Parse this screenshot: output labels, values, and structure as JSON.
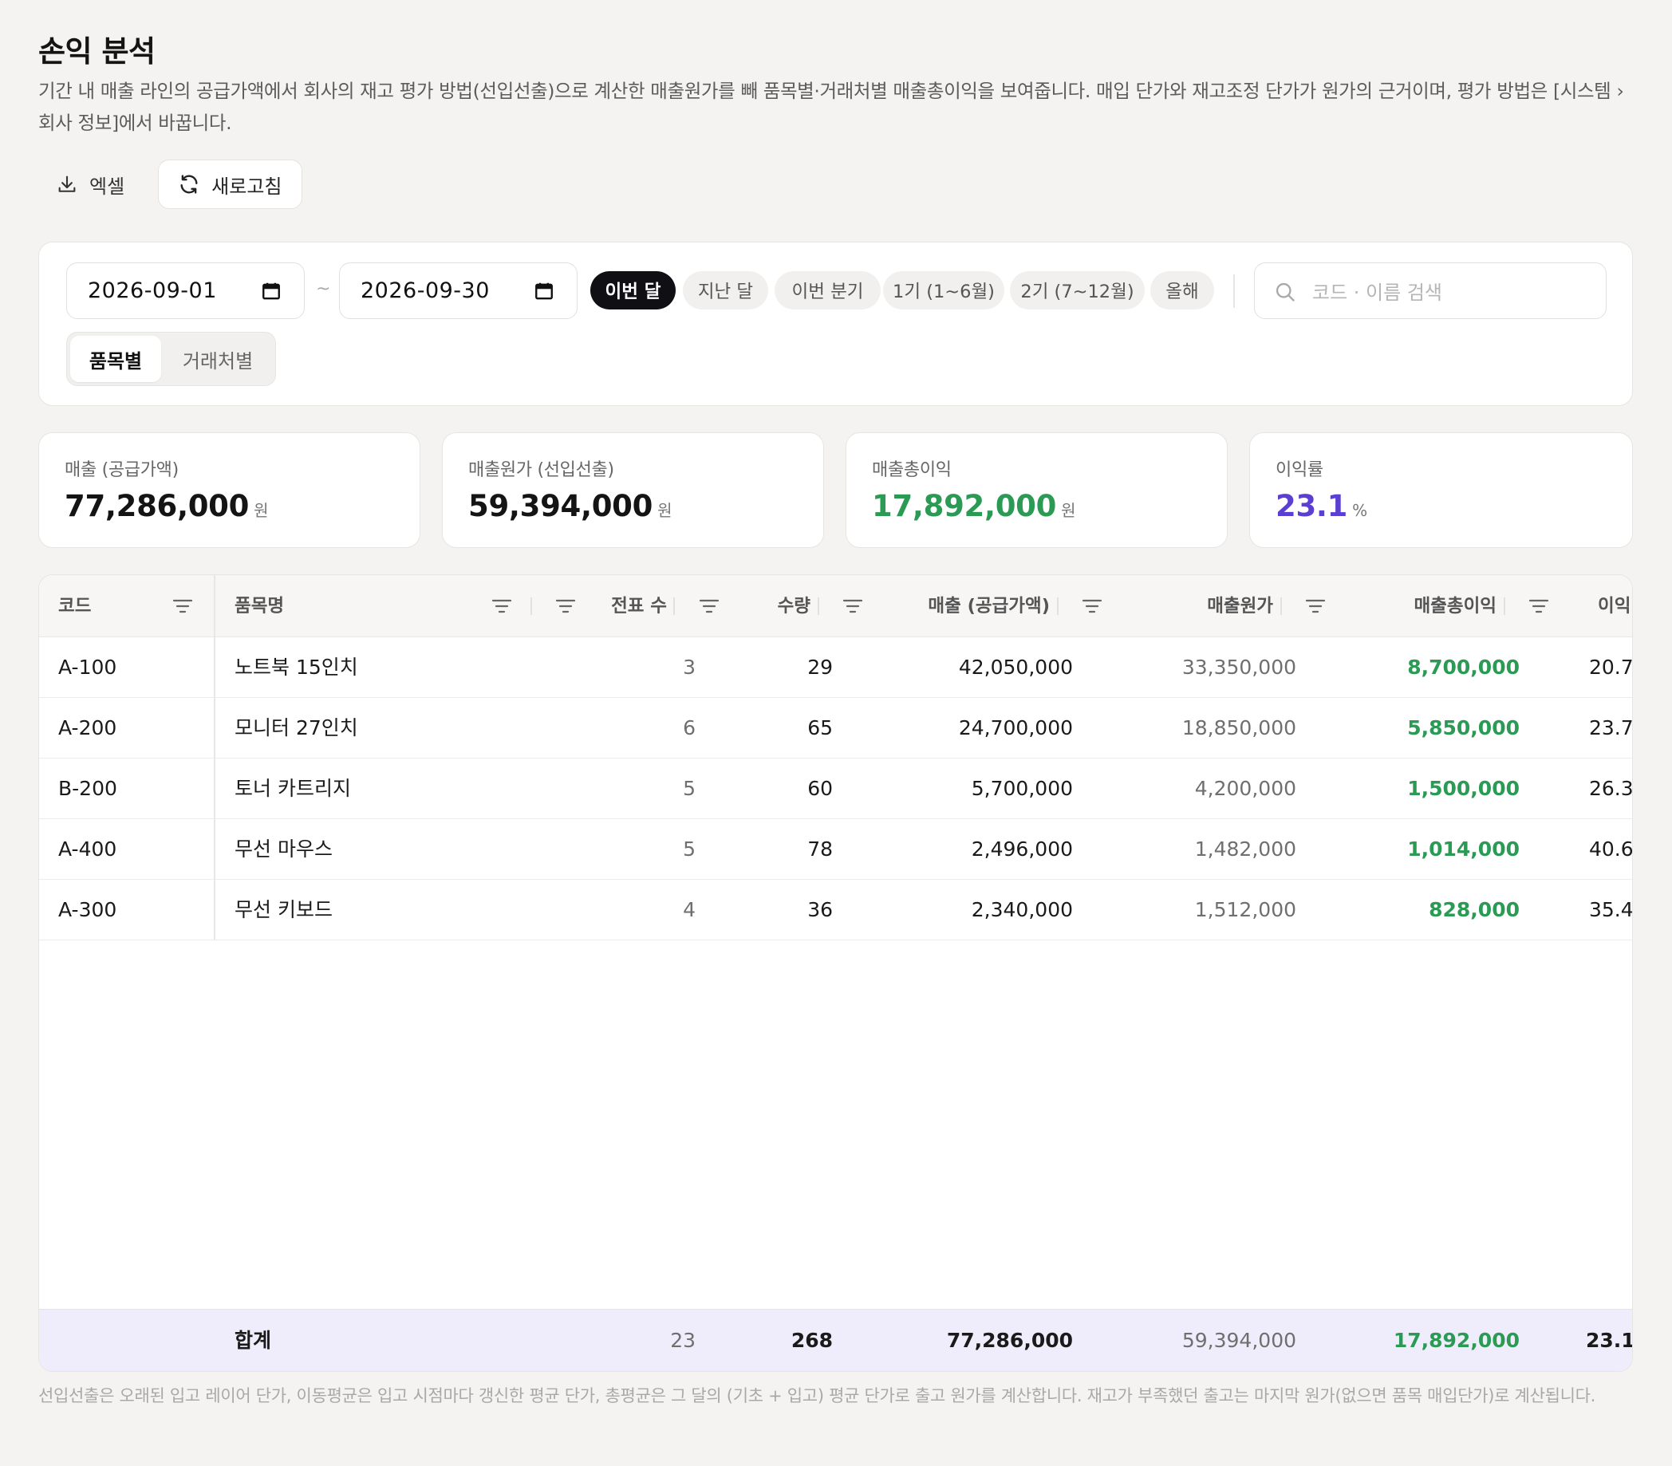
{
  "page": {
    "title": "손익 분석",
    "description": "기간 내 매출 라인의 공급가액에서 회사의 재고 평가 방법(선입선출)으로 계산한 매출원가를 빼 품목별·거래처별 매출총이익을 보여줍니다. 매입 단가와 재고조정 단가가 원가의 근거이며, 평가 방법은 [시스템 › 회사 정보]에서 바꿉니다."
  },
  "toolbar": {
    "excel_label": "엑셀",
    "refresh_label": "새로고침"
  },
  "filters": {
    "date_from": "2026-09-01",
    "date_to": "2026-09-30",
    "separator": "~",
    "presets": [
      "이번 달",
      "지난 달",
      "이번 분기",
      "1기 (1~6월)",
      "2기 (7~12월)",
      "올해"
    ],
    "active_preset": "이번 달",
    "search_placeholder": "코드 · 이름 검색",
    "view_tabs": [
      "품목별",
      "거래처별"
    ],
    "active_view": "품목별"
  },
  "kpis": [
    {
      "label": "매출 (공급가액)",
      "value": "77,286,000",
      "unit": "원",
      "color": "#141414"
    },
    {
      "label": "매출원가 (선입선출)",
      "value": "59,394,000",
      "unit": "원",
      "color": "#141414"
    },
    {
      "label": "매출총이익",
      "value": "17,892,000",
      "unit": "원",
      "color": "#2a9a55"
    },
    {
      "label": "이익률",
      "value": "23.1",
      "unit": "%",
      "color": "#5a3fd0"
    }
  ],
  "table": {
    "headers": [
      "코드",
      "품목명",
      "전표 수",
      "수량",
      "매출 (공급가액)",
      "매출원가",
      "매출총이익",
      "이익"
    ],
    "rows": [
      {
        "code": "A-100",
        "name": "노트북 15인치",
        "slips": "3",
        "qty": "29",
        "sales": "42,050,000",
        "cost": "33,350,000",
        "profit": "8,700,000",
        "margin": "20.7"
      },
      {
        "code": "A-200",
        "name": "모니터 27인치",
        "slips": "6",
        "qty": "65",
        "sales": "24,700,000",
        "cost": "18,850,000",
        "profit": "5,850,000",
        "margin": "23.7"
      },
      {
        "code": "B-200",
        "name": "토너 카트리지",
        "slips": "5",
        "qty": "60",
        "sales": "5,700,000",
        "cost": "4,200,000",
        "profit": "1,500,000",
        "margin": "26.3"
      },
      {
        "code": "A-400",
        "name": "무선 마우스",
        "slips": "5",
        "qty": "78",
        "sales": "2,496,000",
        "cost": "1,482,000",
        "profit": "1,014,000",
        "margin": "40.6"
      },
      {
        "code": "A-300",
        "name": "무선 키보드",
        "slips": "4",
        "qty": "36",
        "sales": "2,340,000",
        "cost": "1,512,000",
        "profit": "828,000",
        "margin": "35.4"
      }
    ],
    "totals": {
      "label": "합계",
      "slips": "23",
      "qty": "268",
      "sales": "77,286,000",
      "cost": "59,394,000",
      "profit": "17,892,000",
      "margin": "23.1'"
    }
  },
  "footnote": "선입선출은 오래된 입고 레이어 단가, 이동평균은 입고 시점마다 갱신한 평균 단가, 총평균은 그 달의 (기초 + 입고) 평균 단가로 출고 원가를 계산합니다. 재고가 부족했던 출고는 마지막 원가(없으면 품목 매입단가)로 계산됩니다.",
  "colors": {
    "profit_green": "#2a9a55",
    "margin_purple": "#5a3fd0",
    "totals_bg": "#efedfb",
    "active_chip": "#0f0f14"
  }
}
